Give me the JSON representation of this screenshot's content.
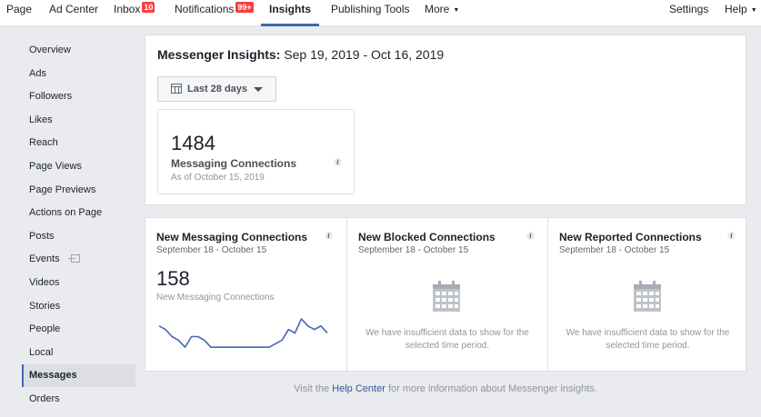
{
  "topnav": {
    "items": [
      {
        "label": "Page"
      },
      {
        "label": "Ad Center"
      },
      {
        "label": "Inbox",
        "badge": "10"
      },
      {
        "label": "Notifications",
        "badge": "99+"
      },
      {
        "label": "Insights",
        "active": true
      },
      {
        "label": "Publishing Tools"
      },
      {
        "label": "More",
        "caret": "▼"
      }
    ],
    "right": [
      {
        "label": "Settings"
      },
      {
        "label": "Help",
        "caret": "▼"
      }
    ]
  },
  "sidebar": {
    "items": [
      "Overview",
      "Ads",
      "Followers",
      "Likes",
      "Reach",
      "Page Views",
      "Page Previews",
      "Actions on Page",
      "Posts",
      "Events",
      "Videos",
      "Stories",
      "People",
      "Local",
      "Messages",
      "Orders"
    ],
    "active": "Messages"
  },
  "header": {
    "title_bold": "Messenger Insights:",
    "date_range": "Sep 19, 2019 - Oct 16, 2019",
    "date_button": "Last 28 days",
    "stat": {
      "value": "1484",
      "label": "Messaging Connections",
      "sub": "As of October 15, 2019"
    }
  },
  "metrics": [
    {
      "title": "New Messaging Connections",
      "range": "September 18 - October 15",
      "value": "158",
      "label": "New Messaging Connections",
      "sparkline": [
        8,
        7,
        5,
        4,
        2,
        5,
        5,
        4,
        2,
        2,
        2,
        2,
        2,
        2,
        2,
        2,
        2,
        2,
        3,
        4,
        7,
        6,
        10,
        8,
        7,
        8,
        6
      ],
      "line_color": "#4267b2"
    },
    {
      "title": "New Blocked Connections",
      "range": "September 18 - October 15",
      "empty": "We have insufficient data to show for the selected time period."
    },
    {
      "title": "New Reported Connections",
      "range": "September 18 - October 15",
      "empty": "We have insufficient data to show for the selected time period."
    }
  ],
  "footer": {
    "before": "Visit the",
    "link": "Help Center",
    "after": "for more information about Messenger insights."
  },
  "colors": {
    "accent": "#4267b2",
    "badge": "#fa3e3e"
  }
}
